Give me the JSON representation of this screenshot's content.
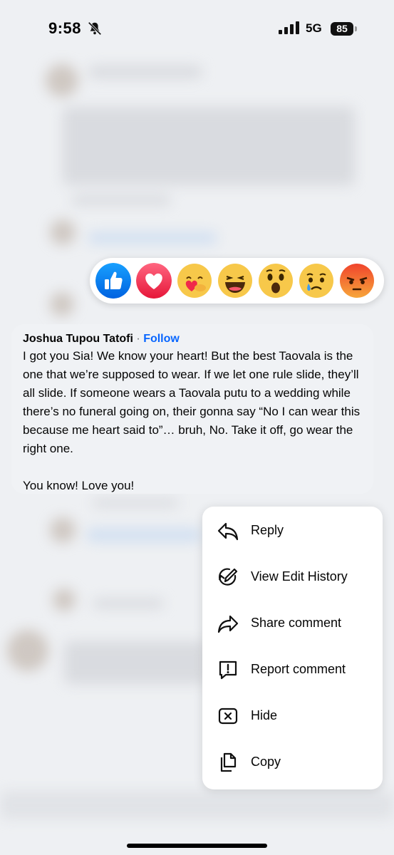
{
  "status_bar": {
    "time": "9:58",
    "network": "5G",
    "battery": "85",
    "icons": [
      "bell-slash-icon",
      "signal-icon",
      "battery-icon"
    ]
  },
  "reactions": [
    {
      "name": "like",
      "icon": "like-icon"
    },
    {
      "name": "love",
      "icon": "love-icon"
    },
    {
      "name": "care",
      "icon": "care-icon"
    },
    {
      "name": "haha",
      "icon": "haha-icon"
    },
    {
      "name": "wow",
      "icon": "wow-icon"
    },
    {
      "name": "sad",
      "icon": "sad-icon"
    },
    {
      "name": "angry",
      "icon": "angry-icon"
    }
  ],
  "comment": {
    "author": "Joshua Tupou Tatofi",
    "separator": "·",
    "follow_label": "Follow",
    "text": "I got you Sia! We know your heart! But the best Taovala is the one that we’re supposed to wear. If we let one rule slide, they’ll all slide. If someone wears a Taovala putu to a wedding while there’s no funeral going on, their gonna say “No I can wear this because me heart said to”… bruh, No. Take it off, go wear the right one.\n\nYou know! Love you!"
  },
  "menu": {
    "items": [
      {
        "label": "Reply",
        "icon": "reply-icon"
      },
      {
        "label": "View Edit History",
        "icon": "edit-history-icon"
      },
      {
        "label": "Share comment",
        "icon": "share-icon"
      },
      {
        "label": "Report comment",
        "icon": "report-icon"
      },
      {
        "label": "Hide",
        "icon": "hide-icon"
      },
      {
        "label": "Copy",
        "icon": "copy-icon"
      }
    ]
  },
  "colors": {
    "accent": "#0866ff",
    "background": "#eef0f3",
    "bubble": "#f0f2f5"
  }
}
